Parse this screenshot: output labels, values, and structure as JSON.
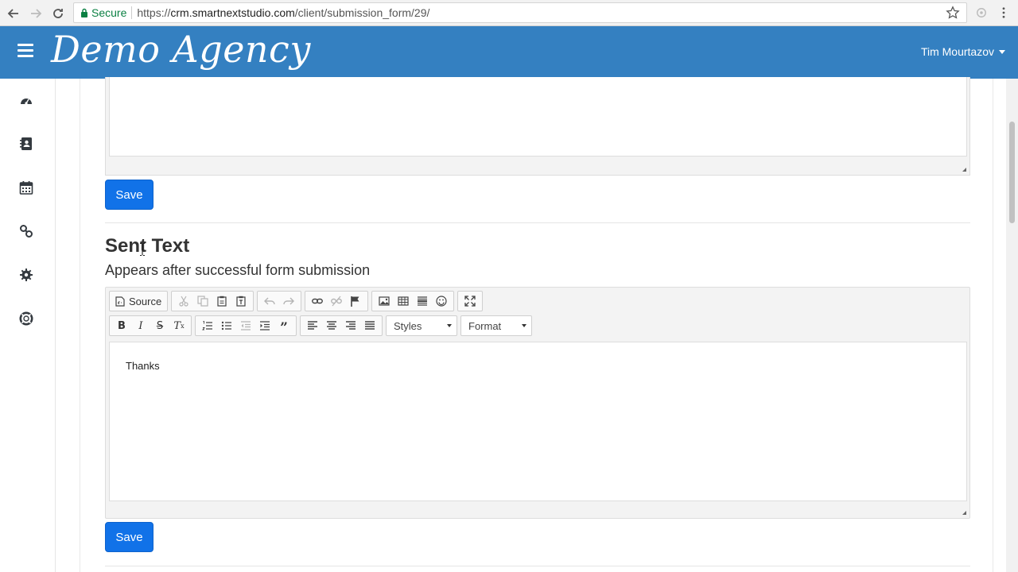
{
  "browser": {
    "secure_label": "Secure",
    "url_scheme": "https://",
    "url_host": "crm.smartnextstudio.com",
    "url_path": "/client/submission_form/29/"
  },
  "header": {
    "brand": "Demo Agency",
    "user_name": "Tim Mourtazov",
    "bg_color": "#3480c1"
  },
  "sidebar": {
    "items": [
      {
        "icon": "dashboard-icon"
      },
      {
        "icon": "contacts-book-icon"
      },
      {
        "icon": "calendar-icon"
      },
      {
        "icon": "link-icon"
      },
      {
        "icon": "gear-icon"
      },
      {
        "icon": "lifebuoy-icon"
      }
    ]
  },
  "main": {
    "save_label": "Save",
    "section": {
      "title": "Sent Text",
      "subtitle": "Appears after successful form submission"
    },
    "editor": {
      "source_label": "Source",
      "styles_label": "Styles",
      "format_label": "Format",
      "content": "Thanks"
    }
  },
  "colors": {
    "primary_button": "#1172e8"
  }
}
